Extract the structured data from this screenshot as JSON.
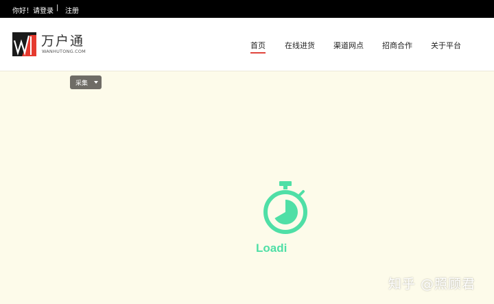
{
  "topbar": {
    "greeting": "你好！请登录",
    "separator": "|",
    "register": "注册"
  },
  "logo": {
    "name_cn": "万户通",
    "name_en": "WANHUTONG.COM"
  },
  "nav": {
    "items": [
      {
        "label": "首页",
        "active": true
      },
      {
        "label": "在线进货",
        "active": false
      },
      {
        "label": "渠道网点",
        "active": false
      },
      {
        "label": "招商合作",
        "active": false
      },
      {
        "label": "关于平台",
        "active": false
      }
    ]
  },
  "collect_dropdown": {
    "label": "采集",
    "icon": "caret-down-icon"
  },
  "loader": {
    "text": "Loadi",
    "icon": "stopwatch-icon",
    "color": "#4fdfa6"
  },
  "watermark": {
    "text": "知乎 @照顾君"
  },
  "colors": {
    "topbar_bg": "#000000",
    "page_bg": "#fdfbea",
    "accent": "#e0433b"
  }
}
